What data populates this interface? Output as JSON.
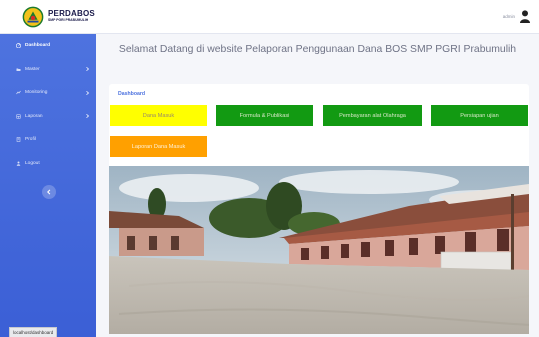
{
  "brand": {
    "title": "PERDABOS",
    "subtitle": "SMP PGRI PRABUMULIH"
  },
  "user": {
    "name": "admin"
  },
  "sidebar": {
    "items": [
      {
        "label": "Dashboard",
        "icon": "dashboard-icon",
        "has_chevron": false,
        "active": true
      },
      {
        "label": "Master",
        "icon": "folder-icon",
        "has_chevron": true,
        "active": false
      },
      {
        "label": "Monitoring",
        "icon": "monitoring-icon",
        "has_chevron": true,
        "active": false
      },
      {
        "label": "Laporan",
        "icon": "report-icon",
        "has_chevron": true,
        "active": false
      },
      {
        "label": "Profil",
        "icon": "profile-icon",
        "has_chevron": false,
        "active": false
      },
      {
        "label": "Logout",
        "icon": "logout-icon",
        "has_chevron": false,
        "active": false
      }
    ],
    "toggle_icon": "chevron-left-icon"
  },
  "status_bar": {
    "url": "localhost/dashboard"
  },
  "main": {
    "welcome": "Selamat Datang di website Pelaporan Penggunaan Dana BOS SMP PGRI Prabumulih",
    "card_title": "Dashboard",
    "buttons": [
      {
        "label": "Dana Masuk",
        "color": "#ffff00"
      },
      {
        "label": "Formula & Publikasi",
        "color": "#129a12"
      },
      {
        "label": "Pembayaran alat Olahraga",
        "color": "#129a12"
      },
      {
        "label": "Persiapan ujian",
        "color": "#129a12"
      },
      {
        "label": "Laporan Dana Masuk",
        "color": "#ffa000"
      }
    ]
  },
  "colors": {
    "sidebar": "#4e73df",
    "accent": "#4e73df",
    "background": "#f5f6fa"
  }
}
